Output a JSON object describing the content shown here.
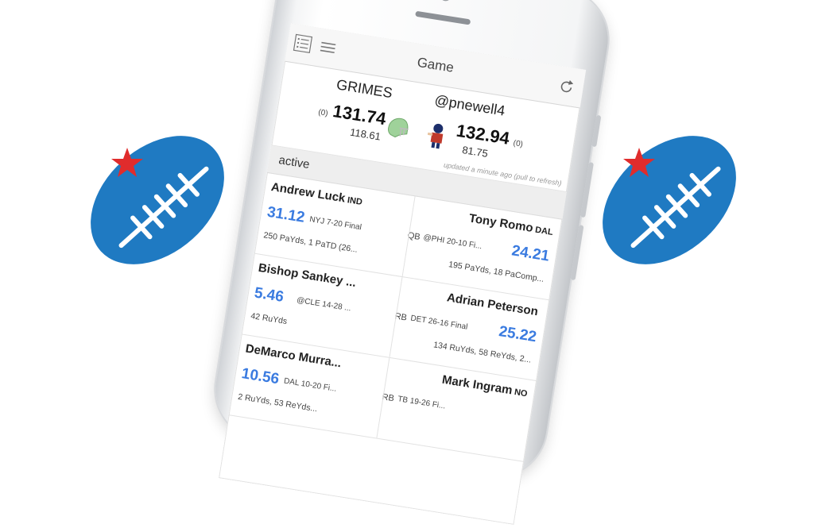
{
  "app": {
    "title": "Game"
  },
  "scoreboard": {
    "left": {
      "name": "GRIMES",
      "rank": "(0)",
      "score": "131.74",
      "projected": "118.61"
    },
    "right": {
      "name": "@pnewell4",
      "rank": "(0)",
      "score": "132.94",
      "projected": "81.75"
    },
    "updated": "updated a minute ago (pull to refresh)"
  },
  "section": {
    "label": "active"
  },
  "matchups": [
    {
      "left": {
        "name": "Andrew Luck",
        "team": "IND",
        "score": "31.12",
        "game": "NYJ 7-20 Final",
        "stats": "250 PaYds, 1 PaTD (26..."
      },
      "position": "QB",
      "right": {
        "name": "Tony Romo",
        "team": "DAL",
        "score": "24.21",
        "game": "@PHI 20-10 Fi...",
        "stats": "195 PaYds, 18 PaComp..."
      }
    },
    {
      "left": {
        "name": "Bishop Sankey ...",
        "team": "",
        "score": "5.46",
        "game": "@CLE 14-28 ...",
        "stats": "42 RuYds"
      },
      "position": "RB",
      "right": {
        "name": "Adrian Peterson",
        "team": "",
        "score": "25.22",
        "game": "DET 26-16 Final",
        "stats": "134 RuYds, 58 ReYds, 2..."
      }
    },
    {
      "left": {
        "name": "DeMarco Murra...",
        "team": "",
        "score": "10.56",
        "game": "DAL 10-20 Fi...",
        "stats": "2 RuYds, 53 ReYds..."
      },
      "position": "RB",
      "right": {
        "name": "Mark Ingram",
        "team": "NO",
        "score": "",
        "game": "TB 19-26 Fi...",
        "stats": ""
      }
    }
  ],
  "colors": {
    "ball_blue": "#1f7ac2",
    "star_red": "#e02c2c",
    "score_blue": "#3a7be0"
  }
}
